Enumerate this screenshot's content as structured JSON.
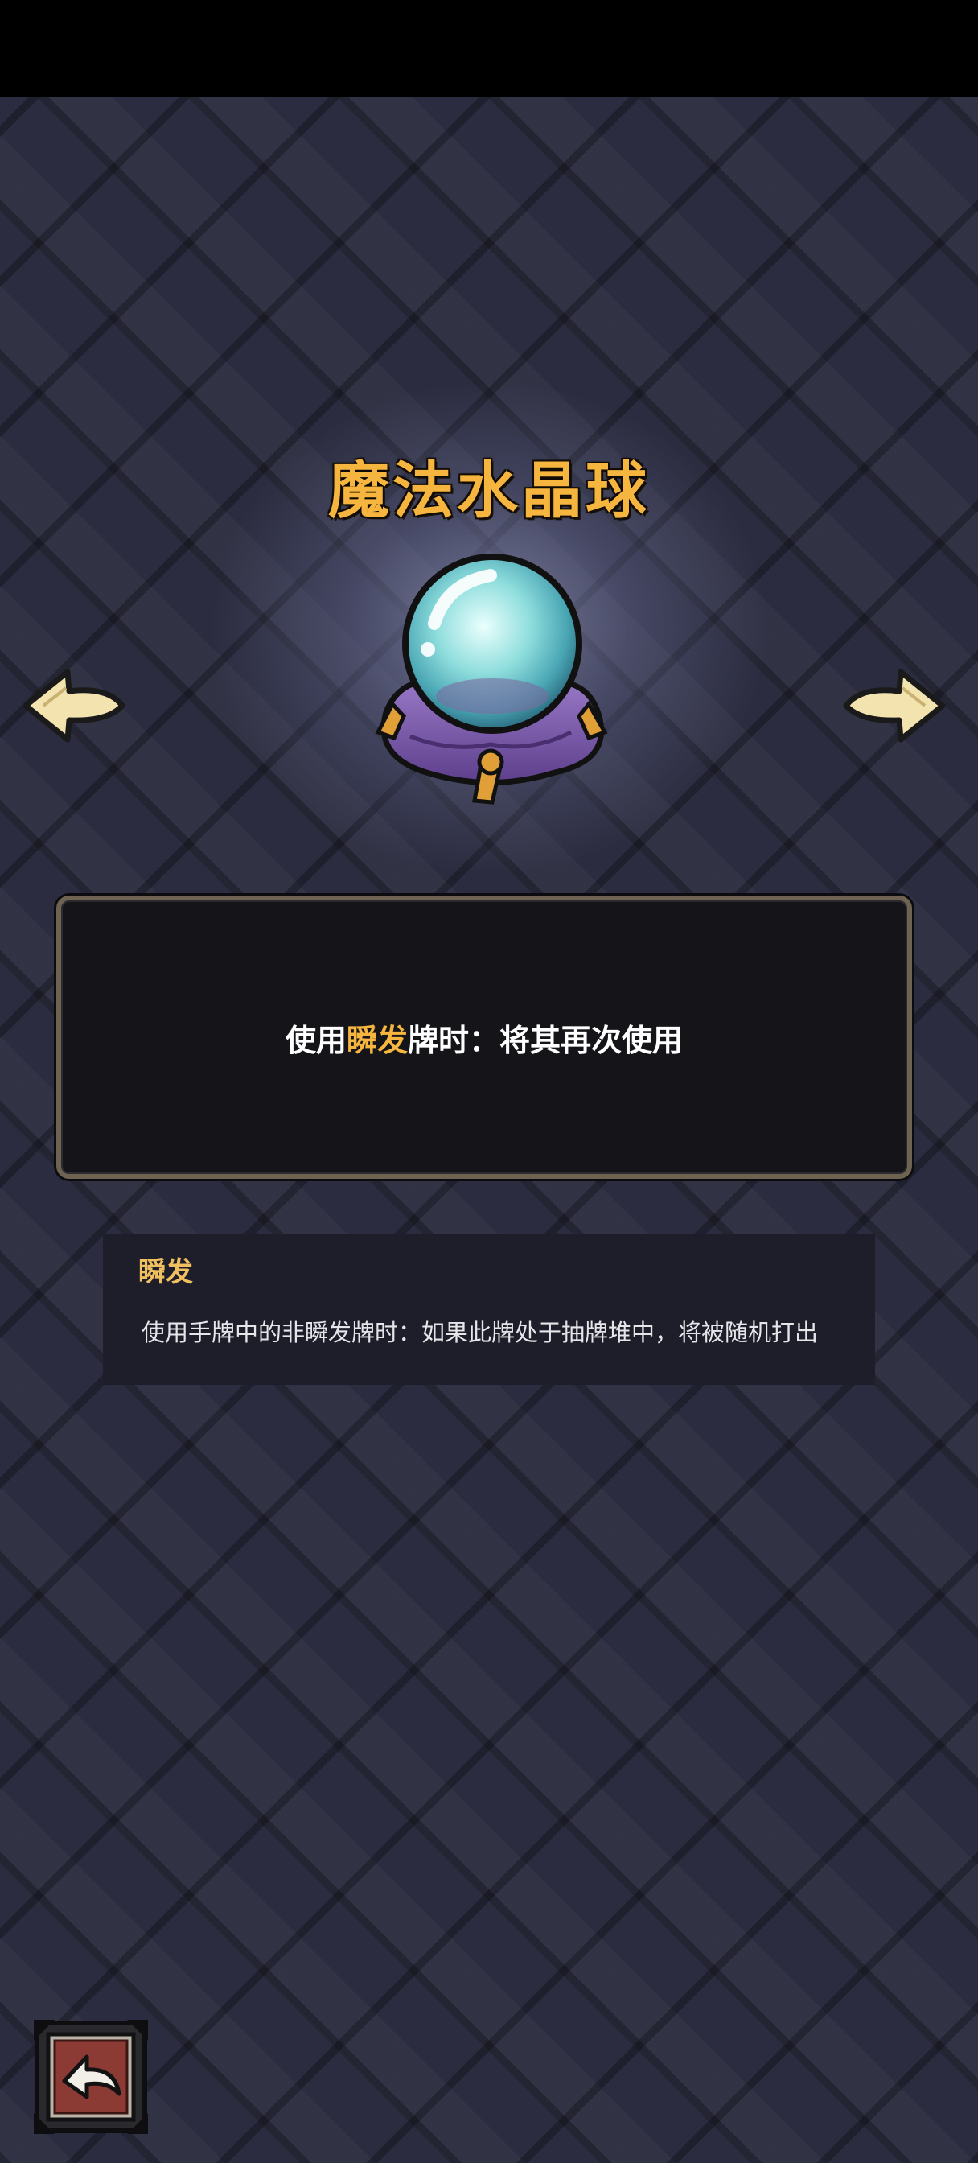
{
  "item": {
    "name": "魔法水晶球",
    "icon": "crystal-ball-icon"
  },
  "description": {
    "prefix": "使用",
    "keyword": "瞬发",
    "suffix": "牌时：将其再次使用"
  },
  "keyword_info": {
    "title": "瞬发",
    "text": "使用手牌中的非瞬发牌时：如果此牌处于抽牌堆中，将被随机打出"
  },
  "navigation": {
    "prev_icon": "arrow-left-icon",
    "next_icon": "arrow-right-icon",
    "back_icon": "return-arrow-icon"
  },
  "colors": {
    "title": "#f5b53f",
    "keyword": "#f5b53f",
    "background": "#2b2c3f",
    "back_button": "#8c3a34"
  }
}
